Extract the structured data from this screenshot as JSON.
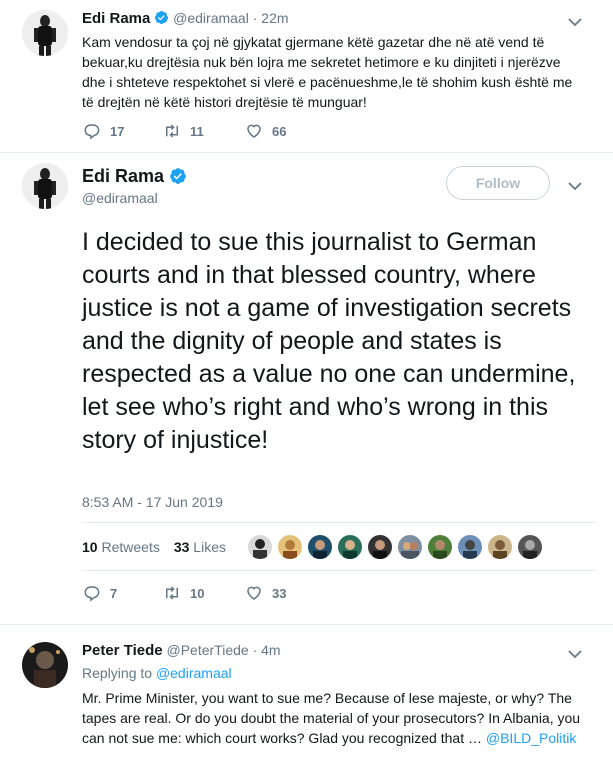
{
  "tweet1": {
    "name": "Edi Rama",
    "handle": "@ediramaal",
    "time": "22m",
    "text": "Kam vendosur ta çoj në gjykatat gjermane këtë gazetar dhe në atë vend të bekuar,ku drejtësia nuk bën lojra me sekretet hetimore e ku dinjiteti i njerëzve dhe i shteteve respektohet si vlerë e pacënueshme,le të shohim kush është me të drejtën në këtë histori drejtësie të munguar!",
    "replies": "17",
    "retweets": "11",
    "likes": "66"
  },
  "tweet2": {
    "name": "Edi Rama",
    "handle": "@ediramaal",
    "follow_label": "Follow",
    "text": "I decided to sue this journalist to German courts and in that blessed country, where justice is not a game of investigation secrets and the dignity of people and states is respected as a value no one can undermine, let see who’s right and who’s wrong in this story of injustice!",
    "timestamp": "8:53 AM - 17 Jun 2019",
    "retweets_count": "10",
    "retweets_label": "Retweets",
    "likes_count": "33",
    "likes_label": "Likes",
    "replies": "7",
    "retweets": "10",
    "likes": "33"
  },
  "tweet3": {
    "name": "Peter Tiede",
    "handle": "@PeterTiede",
    "time": "4m",
    "replying_prefix": "Replying to",
    "replying_to": "@ediramaal",
    "text": "Mr. Prime Minister, you want to sue me?  Because of lese majeste, or why?  The tapes are real. Or do you doubt the material of your prosecutors?  In Albania, you can not sue me: which court works?  Glad you recognized that … ",
    "mention": "@BILD_Politik"
  },
  "colors": {
    "accent": "#1da1f2",
    "muted": "#657786",
    "divider": "#e6ecf0"
  },
  "icons": [
    "verified-icon",
    "chevron-down-icon",
    "reply-icon",
    "retweet-icon",
    "like-icon"
  ]
}
